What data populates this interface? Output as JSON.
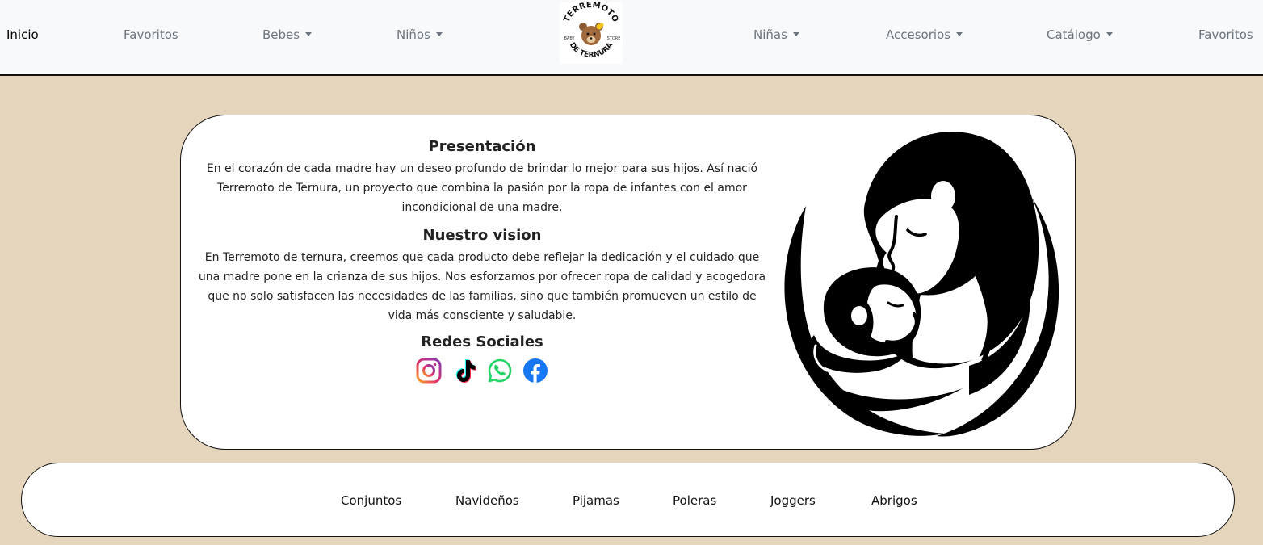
{
  "nav": {
    "left": [
      {
        "label": "Inicio"
      },
      {
        "label": "Favoritos"
      },
      {
        "label": "Bebes"
      },
      {
        "label": "Niños"
      }
    ],
    "right": [
      {
        "label": "Niñas"
      },
      {
        "label": "Accesorios"
      },
      {
        "label": "Catálogo"
      },
      {
        "label": "Favoritos"
      }
    ],
    "logo": {
      "top_text": "TERREMOTO",
      "bottom_text": "DE TERNURA",
      "left_small": "BABY",
      "right_small": "STORE"
    }
  },
  "presentation": {
    "title": "Presentación",
    "body": "En el corazón de cada madre hay un deseo profundo de brindar lo mejor para sus hijos. Así nació Terremoto de Ternura, un proyecto que combina la pasión por la ropa de infantes con el amor incondicional de una madre."
  },
  "vision": {
    "title": "Nuestro vision",
    "body": "En Terremoto de ternura, creemos que cada producto debe reflejar la dedicación y el cuidado que una madre pone en la crianza de sus hijos. Nos esforzamos por ofrecer ropa de calidad y acogedora que no solo satisfacen las necesidades de las familias, sino que también promueven un estilo de vida más consciente y saludable."
  },
  "social": {
    "title": "Redes Sociales",
    "icons": [
      "instagram-icon",
      "tiktok-icon",
      "whatsapp-icon",
      "facebook-icon"
    ],
    "colors": {
      "whatsapp": "#25d366",
      "facebook": "#1877f2",
      "tiktok": "#000000"
    }
  },
  "categories": [
    "Conjuntos",
    "Navideños",
    "Pijamas",
    "Poleras",
    "Joggers",
    "Abrigos"
  ],
  "colors": {
    "page_bg": "#e6d5bd",
    "navbar_bg": "#f8f9fa",
    "nav_text": "#6c757d"
  }
}
